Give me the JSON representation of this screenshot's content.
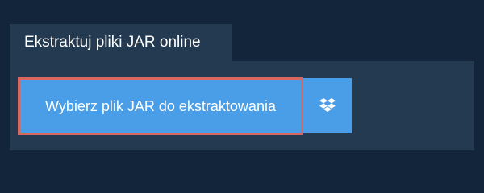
{
  "tab": {
    "label": "Ekstraktuj pliki JAR online"
  },
  "upload": {
    "button_label": "Wybierz plik JAR do ekstraktowania",
    "dropbox_icon": "dropbox-icon"
  },
  "colors": {
    "background": "#13253b",
    "panel": "#233a51",
    "button": "#4a9ee8",
    "focus_border": "#d9675f",
    "text": "#ffffff"
  }
}
